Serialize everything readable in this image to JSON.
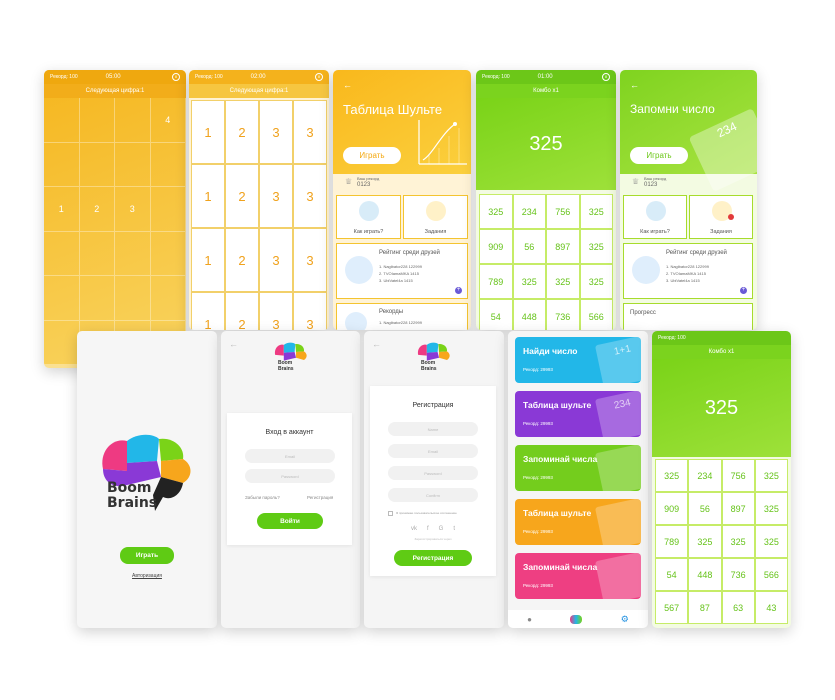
{
  "colors": {
    "orange": "#f4b31e",
    "green": "#7fd321",
    "brand_green": "#5fcb14"
  },
  "s1": {
    "record": "Рекорд: 100",
    "time": "05:00",
    "next": "Следующая цифра:1",
    "cells": [
      "",
      "",
      "",
      "4",
      "",
      "",
      "",
      "",
      "1",
      "2",
      "3",
      "",
      "",
      "",
      "",
      "",
      "",
      "",
      "",
      "",
      "",
      "",
      "",
      "",
      "",
      "",
      "",
      "",
      "",
      "",
      "",
      "",
      "",
      "",
      "",
      ""
    ]
  },
  "s2": {
    "record": "Рекорд: 100",
    "time": "02:00",
    "next": "Следующая цифра:1",
    "cells": [
      "1",
      "2",
      "3",
      "3",
      "1",
      "2",
      "3",
      "3",
      "1",
      "2",
      "3",
      "3",
      "1",
      "2",
      "3",
      "3"
    ]
  },
  "s3": {
    "title": "Таблица Шульте",
    "play": "Играть",
    "record_label": "Ваш рекорд",
    "record_value": "0123",
    "how": "Как играть?",
    "tasks": "Задания",
    "rating_title": "Рейтинг среди друзей",
    "rating": [
      "1. Nagibator228   122999",
      "2. TVOIamaMKA      1415",
      "3. UbiVatel4a       1415"
    ],
    "records": "Рекорды",
    "records_row": "1. Nagibator228   122999"
  },
  "s4": {
    "record": "Рекорд: 100",
    "time": "01:00",
    "combo": "Комбо x1",
    "big": "325",
    "cells": [
      "325",
      "234",
      "756",
      "325",
      "909",
      "56",
      "897",
      "325",
      "789",
      "325",
      "325",
      "325",
      "54",
      "448",
      "736",
      "566"
    ]
  },
  "s5": {
    "title": "Запомни число",
    "play": "Играть",
    "deco": "234",
    "record_label": "Ваш рекорд",
    "record_value": "0123",
    "how": "Как играть?",
    "tasks": "Задания",
    "rating_title": "Рейтинг среди друзей",
    "rating": [
      "1. Nagibator228   122999",
      "2. TVOIamaMKA      1415",
      "3. UbiVatel4a       1415"
    ],
    "progress": "Прогресс"
  },
  "s6": {
    "brand1": "Boom",
    "brand2": "Brains",
    "play": "Играть",
    "auth": "Авторизация"
  },
  "s7": {
    "brand1": "Boom",
    "brand2": "Brains",
    "heading": "Вход в аккаунт",
    "email": "Email",
    "password": "Password",
    "forgot": "Забыли пароль?",
    "register": "Регистрация",
    "login": "Войти"
  },
  "s8": {
    "brand1": "Boom",
    "brand2": "Brains",
    "heading": "Регистрация",
    "name": "Name",
    "email": "Email",
    "password": "Password",
    "confirm": "Confirm",
    "agree": "Я принимаю пользовательское соглашение",
    "social_note": "Зарегистрироваться через",
    "register": "Регистрация"
  },
  "s9": {
    "games": [
      {
        "title": "Найди число",
        "record": "Рекорд: 29993",
        "color": "#22b7e8",
        "deco": "1+1"
      },
      {
        "title": "Таблица шульте",
        "record": "Рекорд: 29993",
        "color": "#8a39d6",
        "deco": "234"
      },
      {
        "title": "Запоминай числа",
        "record": "Рекорд: 29993",
        "color": "#74cd1d",
        "deco": ""
      },
      {
        "title": "Таблица шульте",
        "record": "Рекорд: 29993",
        "color": "#f7a61c",
        "deco": ""
      },
      {
        "title": "Запоминай числа",
        "record": "Рекорд: 29993",
        "color": "#ee3f82",
        "deco": ""
      }
    ]
  },
  "s10": {
    "record": "Рекорд: 100",
    "combo": "Комбо x1",
    "big": "325",
    "cells": [
      "325",
      "234",
      "756",
      "325",
      "909",
      "56",
      "897",
      "325",
      "789",
      "325",
      "325",
      "325",
      "54",
      "448",
      "736",
      "566",
      "567",
      "87",
      "63",
      "43"
    ]
  }
}
